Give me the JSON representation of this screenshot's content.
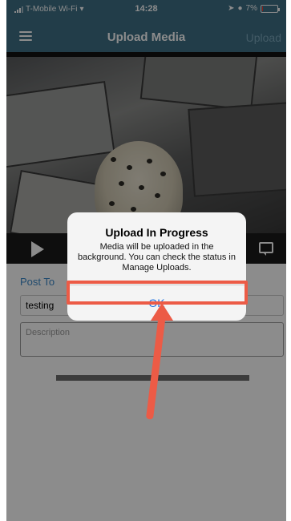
{
  "status_bar": {
    "carrier": "T-Mobile Wi-Fi",
    "time": "14:28",
    "battery": "7%"
  },
  "nav": {
    "title": "Upload Media",
    "action_label": "Upload"
  },
  "form": {
    "post_to_label": "Post To",
    "title_value": "testing",
    "description_placeholder": "Description"
  },
  "alert": {
    "title": "Upload In Progress",
    "message": "Media will be uploaded in the background. You can check the status in Manage Uploads.",
    "ok_label": "OK"
  },
  "colors": {
    "nav_bar": "#3e6f86",
    "link_blue": "#1a6fe0",
    "annotation": "#ec5b46"
  },
  "icons": [
    "menu-icon",
    "play-icon",
    "caption-icon",
    "wifi-icon",
    "battery-icon"
  ],
  "battery_level": 0.07
}
